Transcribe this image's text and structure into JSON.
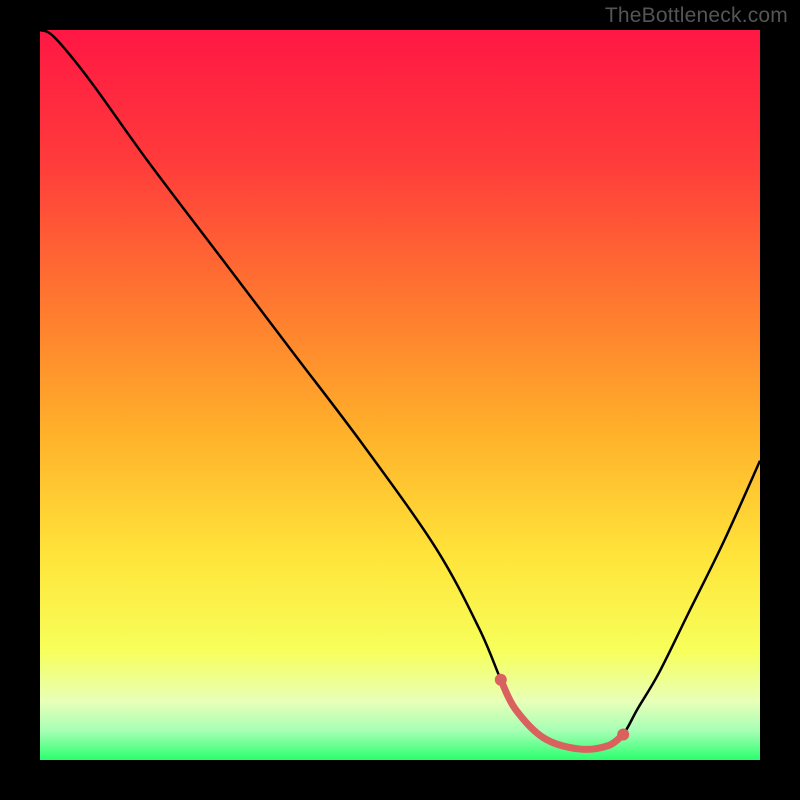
{
  "watermark": "TheBottleneck.com",
  "chart_data": {
    "type": "line",
    "title": "",
    "xlabel": "",
    "ylabel": "",
    "xlim": [
      0,
      100
    ],
    "ylim": [
      0,
      100
    ],
    "grid": false,
    "legend": false,
    "gradient_stops": [
      {
        "offset": 0,
        "color": "#ff1744"
      },
      {
        "offset": 18,
        "color": "#ff3b3b"
      },
      {
        "offset": 38,
        "color": "#ff7a2f"
      },
      {
        "offset": 55,
        "color": "#ffb02a"
      },
      {
        "offset": 72,
        "color": "#ffe43a"
      },
      {
        "offset": 85,
        "color": "#f7ff5a"
      },
      {
        "offset": 92,
        "color": "#e8ffb8"
      },
      {
        "offset": 96,
        "color": "#a6ffb5"
      },
      {
        "offset": 100,
        "color": "#2bff6e"
      }
    ],
    "series": [
      {
        "name": "bottleneck-curve",
        "color": "#000000",
        "x": [
          0,
          2,
          7,
          15,
          25,
          35,
          45,
          55,
          61,
          64,
          66,
          70,
          75,
          79,
          81,
          83,
          86,
          90,
          95,
          100
        ],
        "y": [
          100,
          99,
          93,
          82,
          69,
          56,
          43,
          29,
          18,
          11,
          7,
          3,
          1.5,
          2,
          3.5,
          7,
          12,
          20,
          30,
          41
        ]
      }
    ],
    "highlight_segment": {
      "name": "minimum-band",
      "color": "#d9625f",
      "x": [
        64,
        66,
        70,
        75,
        79,
        81
      ],
      "y": [
        11,
        7,
        3,
        1.5,
        2,
        3.5
      ]
    },
    "highlight_endpoints": {
      "color": "#d9625f",
      "points": [
        {
          "x": 64,
          "y": 11
        },
        {
          "x": 81,
          "y": 3.5
        }
      ]
    }
  }
}
